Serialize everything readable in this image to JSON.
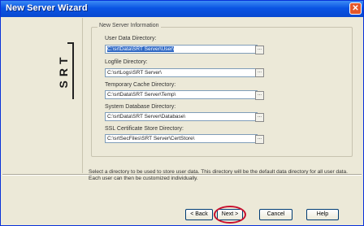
{
  "window": {
    "title": "New Server Wizard",
    "close_label": "✕"
  },
  "logo": {
    "letters": [
      "S",
      "R",
      "T"
    ]
  },
  "group": {
    "legend": "New Server Information"
  },
  "fields": [
    {
      "label": "User Data Directory:",
      "value": "C:\\srtData\\SRT Server\\User\\",
      "selected": true
    },
    {
      "label": "Logfile Directory:",
      "value": "C:\\srtLogs\\SRT Server\\",
      "selected": false
    },
    {
      "label": "Temporary Cache Directory:",
      "value": "C:\\srtData\\SRT Server\\Temp\\",
      "selected": false
    },
    {
      "label": "System Database Directory:",
      "value": "C:\\srtData\\SRT Server\\Database\\",
      "selected": false
    },
    {
      "label": "SSL Certificate Store Directory:",
      "value": "C:\\srtSecFiles\\SRT Server\\CertStore\\",
      "selected": false
    }
  ],
  "browse_label": "...",
  "description": "Select a directory to be used to store user data. This directory will be the default data directory for all user data. Each user can then be customized individually.",
  "buttons": {
    "back": "< Back",
    "next": "Next >",
    "cancel": "Cancel",
    "help": "Help"
  }
}
